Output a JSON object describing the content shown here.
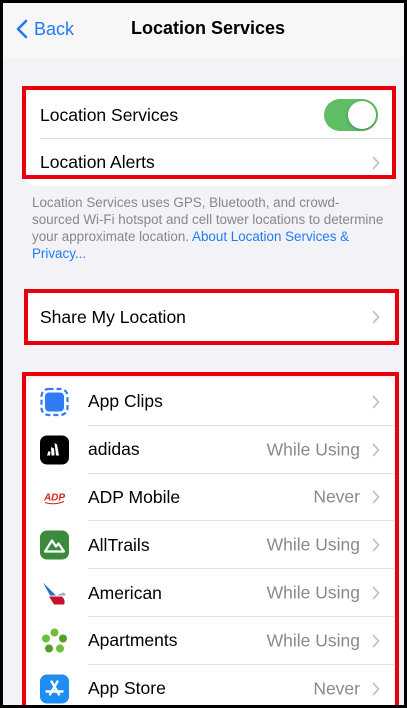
{
  "nav": {
    "back_label": "Back",
    "title": "Location Services"
  },
  "top_group": {
    "location_services_label": "Location Services",
    "location_services_on": true,
    "location_alerts_label": "Location Alerts"
  },
  "footnote": {
    "text": "Location Services uses GPS, Bluetooth, and crowd-sourced Wi-Fi hotspot and cell tower locations to determine your approximate location. ",
    "link": "About Location Services & Privacy..."
  },
  "share": {
    "label": "Share My Location"
  },
  "apps": [
    {
      "name": "App Clips",
      "value": "",
      "icon": "app-clips-icon"
    },
    {
      "name": "adidas",
      "value": "While Using",
      "icon": "adidas-icon"
    },
    {
      "name": "ADP Mobile",
      "value": "Never",
      "icon": "adp-icon"
    },
    {
      "name": "AllTrails",
      "value": "While Using",
      "icon": "alltrails-icon"
    },
    {
      "name": "American",
      "value": "While Using",
      "icon": "american-airlines-icon"
    },
    {
      "name": "Apartments",
      "value": "While Using",
      "icon": "apartments-icon"
    },
    {
      "name": "App Store",
      "value": "Never",
      "icon": "app-store-icon"
    }
  ],
  "colors": {
    "accent": "#1e7bf6",
    "toggle_on": "#5fbd63",
    "highlight": "#e8000c",
    "background": "#f2f2f7"
  }
}
